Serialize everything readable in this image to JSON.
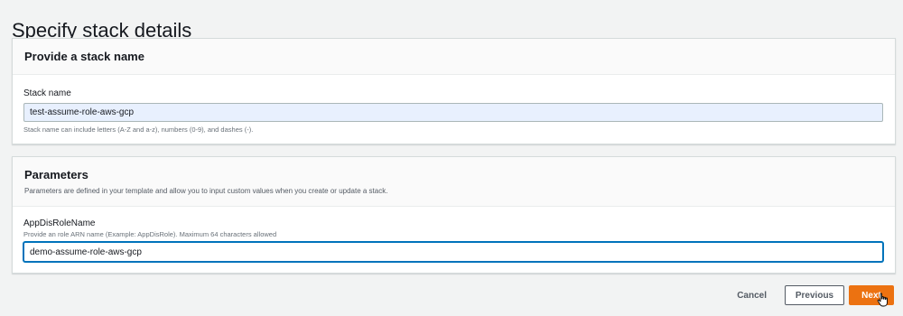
{
  "page": {
    "title": "Specify stack details"
  },
  "stack_section": {
    "title": "Provide a stack name",
    "field_label": "Stack name",
    "value": "test-assume-role-aws-gcp",
    "constraint": "Stack name can include letters (A-Z and a-z), numbers (0-9), and dashes (-)."
  },
  "parameters_section": {
    "title": "Parameters",
    "description": "Parameters are defined in your template and allow you to input custom values when you create or update a stack.",
    "param_label": "AppDisRoleName",
    "param_description": "Provide an role ARN name (Example: AppDisRole). Maximum 64 characters allowed",
    "value": "demo-assume-role-aws-gcp"
  },
  "actions": {
    "cancel_label": "Cancel",
    "previous_label": "Previous",
    "next_label": "Next"
  },
  "colors": {
    "primary_button": "#ec7211",
    "focus_border": "#0073bb",
    "autofill_background": "#e8f0fe"
  },
  "icons": {
    "cursor": "hand-pointer-icon"
  }
}
